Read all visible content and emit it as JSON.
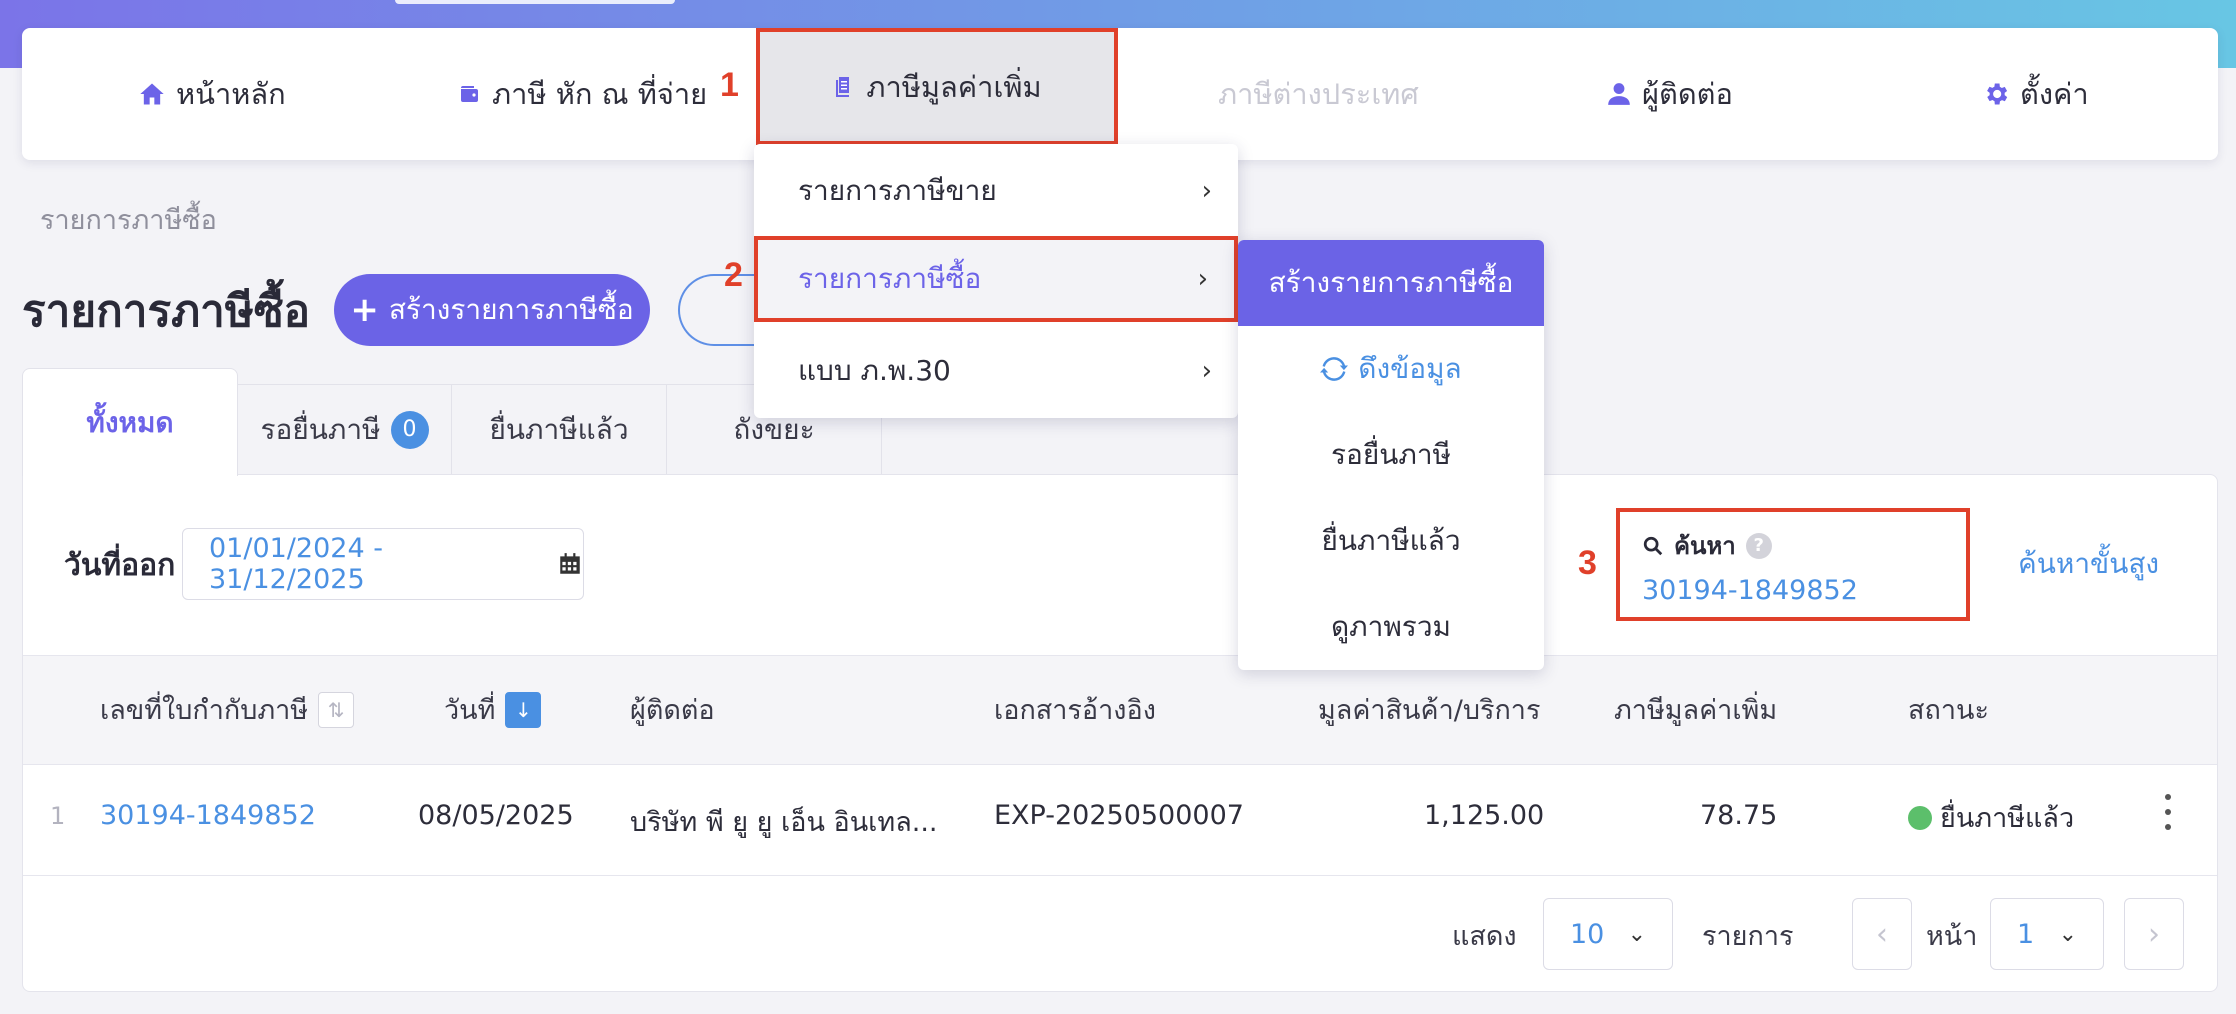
{
  "nav": {
    "home": "หน้าหลัก",
    "wht": "ภาษี หัก ณ ที่จ่าย",
    "vat": "ภาษีมูลค่าเพิ่ม",
    "foreign": "ภาษีต่างประเทศ",
    "contacts": "ผู้ติดต่อ",
    "settings": "ตั้งค่า"
  },
  "annotations": {
    "step1": "1",
    "step2": "2",
    "step3": "3"
  },
  "menu_level1": {
    "items": [
      "รายการภาษีขาย",
      "รายการภาษีซื้อ",
      "แบบ ภ.พ.30"
    ],
    "selected_index": 1
  },
  "menu_level2": {
    "create": "สร้างรายการภาษีซื้อ",
    "fetch": "ดึงข้อมูล",
    "pending": "รอยื่นภาษี",
    "filed": "ยื่นภาษีแล้ว",
    "overview": "ดูภาพรวม"
  },
  "breadcrumb": "รายการภาษีซื้อ",
  "page_title": "รายการภาษีซื้อ",
  "create_button": "สร้างรายการภาษีซื้อ",
  "tabs": [
    {
      "label": "ทั้งหมด",
      "active": true
    },
    {
      "label": "รอยื่นภาษี",
      "badge": "0"
    },
    {
      "label": "ยื่นภาษีแล้ว"
    },
    {
      "label": "ถังขยะ"
    }
  ],
  "filters": {
    "date_label": "วันที่ออก",
    "date_range": "01/01/2024 - 31/12/2025",
    "search_label": "ค้นหา",
    "search_value": "30194-1849852",
    "advanced_search": "ค้นหาขั้นสูง"
  },
  "table": {
    "headers": [
      "เลขที่ใบกำกับภาษี",
      "วันที่",
      "ผู้ติดต่อ",
      "เอกสารอ้างอิง",
      "มูลค่าสินค้า/บริการ",
      "ภาษีมูลค่าเพิ่ม",
      "สถานะ"
    ],
    "rows": [
      {
        "index": "1",
        "invoice_no": "30194-1849852",
        "date": "08/05/2025",
        "contact": "บริษัท พี ยู ยู เอ็น อินเทล...",
        "reference": "EXP-20250500007",
        "amount": "1,125.00",
        "vat": "78.75",
        "status": "ยื่นภาษีแล้ว"
      }
    ]
  },
  "pagination": {
    "show_label": "แสดง",
    "per_page": "10",
    "items_label": "รายการ",
    "page_label": "หน้า",
    "page": "1"
  },
  "colors": {
    "accent": "#6b63e6",
    "link": "#4a90e2",
    "highlight": "#e0402a",
    "status_ok": "#5cbf6b"
  }
}
